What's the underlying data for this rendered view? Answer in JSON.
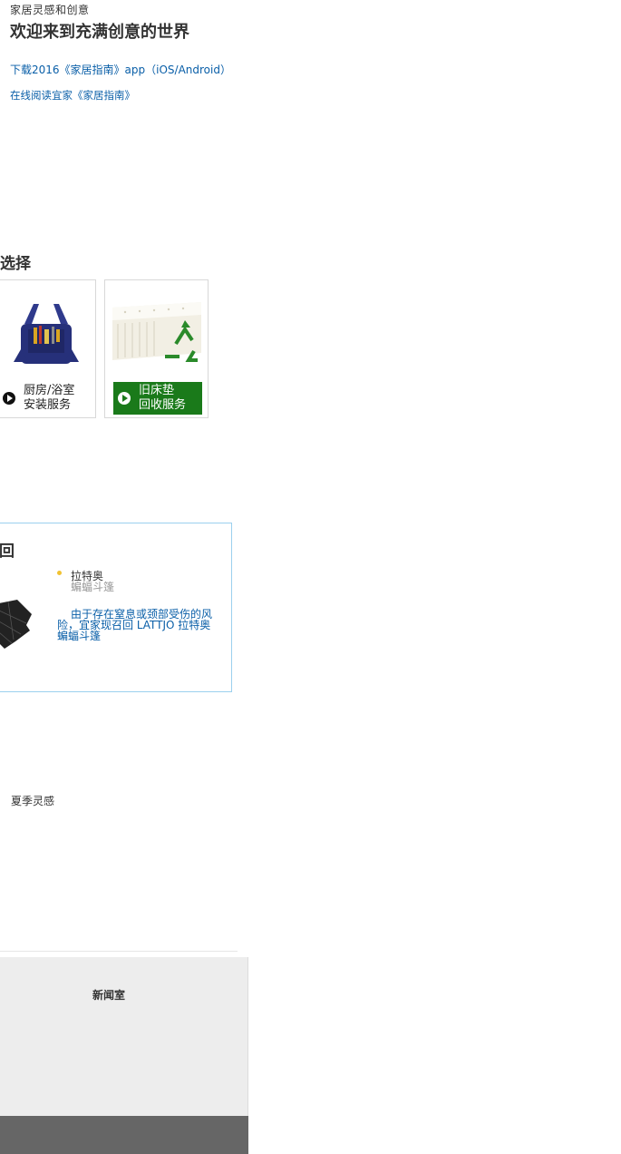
{
  "inspiration": {
    "eyebrow": "家居灵感和创意",
    "title": "欢迎来到充满创意的世界"
  },
  "guide_links": [
    "下载2016《家居指南》app（iOS/Android）",
    "在线阅读宜家《家居指南》"
  ],
  "services": {
    "heading": "选择",
    "cards": [
      {
        "line1": "厨房/浴室",
        "line2": "安装服务",
        "icon": "play-icon"
      },
      {
        "line1": "旧床垫",
        "line2": "回收服务",
        "icon": "play-icon"
      }
    ]
  },
  "recall": {
    "heading": "回",
    "product": "拉特奥",
    "product_sub": "蝙蝠斗篷",
    "note": "由于存在窒息或颈部受伤的风险，宜家现召回 LATTJO 拉特奥 蝙蝠斗篷"
  },
  "summer": {
    "label": "夏季灵感"
  },
  "footer": {
    "newsroom": "新闻室"
  },
  "colors": {
    "link": "#0a5fa8",
    "green": "#1a7a1a",
    "recall_border": "#9bd0ee",
    "bullet": "#f1c232",
    "footer_gray": "#ededed",
    "footer_dark": "#666666"
  }
}
